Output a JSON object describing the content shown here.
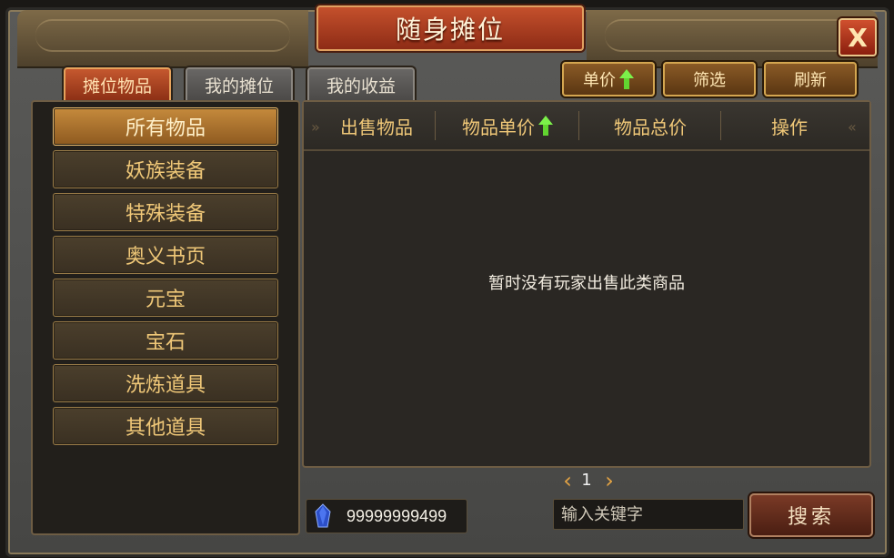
{
  "window": {
    "title": "随身摊位",
    "close_label": "X"
  },
  "tabs": [
    {
      "label": "摊位物品",
      "active": true
    },
    {
      "label": "我的摊位",
      "active": false
    },
    {
      "label": "我的收益",
      "active": false
    }
  ],
  "header_buttons": {
    "unit_price": "单价",
    "filter": "筛选",
    "refresh": "刷新"
  },
  "categories": [
    {
      "label": "所有物品",
      "selected": true
    },
    {
      "label": "妖族装备",
      "selected": false
    },
    {
      "label": "特殊装备",
      "selected": false
    },
    {
      "label": "奥义书页",
      "selected": false
    },
    {
      "label": "元宝",
      "selected": false
    },
    {
      "label": "宝石",
      "selected": false
    },
    {
      "label": "洗炼道具",
      "selected": false
    },
    {
      "label": "其他道具",
      "selected": false
    }
  ],
  "table": {
    "columns": [
      "出售物品",
      "物品单价",
      "物品总价",
      "操作"
    ],
    "empty_message": "暂时没有玩家出售此类商品"
  },
  "pager": {
    "current_page": "1"
  },
  "currency": {
    "icon": "blue-gem-icon",
    "amount": "99999999499"
  },
  "search": {
    "placeholder": "输入关键字",
    "button_label": "搜索"
  },
  "colors": {
    "accent_gold": "#f0c878",
    "title_red": "#b0401f",
    "sort_arrow_green": "#7cf04a"
  }
}
